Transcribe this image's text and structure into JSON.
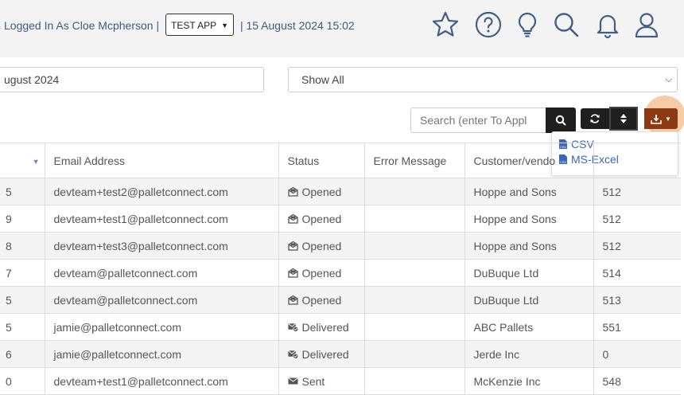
{
  "header": {
    "logged_in_text": "Logged In As Cloe Mcpherson",
    "separator": "|",
    "app_selected": "TEST APP",
    "separator2": "|",
    "datetime": "15 August 2024 15:02",
    "icons": [
      "star-icon",
      "help-icon",
      "lightbulb-icon",
      "search-icon",
      "bell-icon",
      "user-icon"
    ]
  },
  "filters": {
    "date_range_value": "ugust 2024",
    "status_filter_value": "Show All"
  },
  "toolbar": {
    "search_placeholder": "Search (enter To Appl",
    "export_menu": {
      "csv_label": "CSV",
      "excel_label": "MS-Excel"
    }
  },
  "table": {
    "columns": [
      "",
      "Email Address",
      "Status",
      "Error Message",
      "Customer/vendo",
      ""
    ],
    "rows": [
      {
        "id": "5",
        "email": "devteam+test2@palletconnect.com",
        "status": "Opened",
        "status_icon": "envelope-open-icon",
        "error": "",
        "customer": "Hoppe and Sons",
        "ref": "512"
      },
      {
        "id": "9",
        "email": "devteam+test1@palletconnect.com",
        "status": "Opened",
        "status_icon": "envelope-open-icon",
        "error": "",
        "customer": "Hoppe and Sons",
        "ref": "512"
      },
      {
        "id": "8",
        "email": "devteam+test3@palletconnect.com",
        "status": "Opened",
        "status_icon": "envelope-open-icon",
        "error": "",
        "customer": "Hoppe and Sons",
        "ref": "512"
      },
      {
        "id": "7",
        "email": "devteam@palletconnect.com",
        "status": "Opened",
        "status_icon": "envelope-open-icon",
        "error": "",
        "customer": "DuBuque Ltd",
        "ref": "514"
      },
      {
        "id": "5",
        "email": "devteam@palletconnect.com",
        "status": "Opened",
        "status_icon": "envelope-open-icon",
        "error": "",
        "customer": "DuBuque Ltd",
        "ref": "513"
      },
      {
        "id": "5",
        "email": "jamie@palletconnect.com",
        "status": "Delivered",
        "status_icon": "envelope-check-icon",
        "error": "",
        "customer": "ABC Pallets",
        "ref": "551"
      },
      {
        "id": "6",
        "email": "jamie@palletconnect.com",
        "status": "Delivered",
        "status_icon": "envelope-check-icon",
        "error": "",
        "customer": "Jerde Inc",
        "ref": "0"
      },
      {
        "id": "0",
        "email": "devteam+test1@palletconnect.com",
        "status": "Sent",
        "status_icon": "envelope-icon",
        "error": "",
        "customer": "McKenzie Inc",
        "ref": "548"
      }
    ]
  },
  "colors": {
    "accent_blue": "#3a67b7",
    "export_button": "#8b3a13",
    "highlight": "#f08c3c"
  }
}
